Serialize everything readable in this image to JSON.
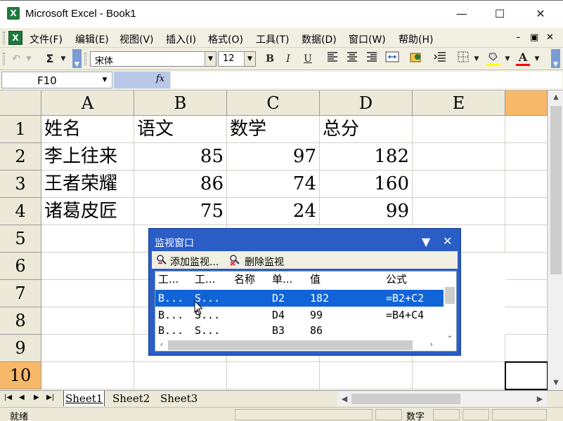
{
  "window": {
    "title": "Microsoft Excel - Book1",
    "minimize": "—",
    "maximize": "☐",
    "close": "✕",
    "icon": "X"
  },
  "menubar": {
    "items": [
      "文件(F)",
      "编辑(E)",
      "视图(V)",
      "插入(I)",
      "格式(O)",
      "工具(T)",
      "数据(D)",
      "窗口(W)",
      "帮助(H)"
    ],
    "mdi_min": "–",
    "mdi_restore": "▣",
    "mdi_close": "✕"
  },
  "toolbar": {
    "undo": "↶",
    "autosum": "Σ",
    "font_name": "宋体",
    "font_size": "12",
    "bold": "B",
    "italic": "I",
    "underline": "U",
    "fill_color": "#ffff00",
    "font_color": "#ff0000",
    "font_color_letter": "A"
  },
  "formula_bar": {
    "name_box": "F10",
    "fx": "fx",
    "formula": ""
  },
  "grid": {
    "columns": [
      "A",
      "B",
      "C",
      "D",
      "E"
    ],
    "rows": [
      "1",
      "2",
      "3",
      "4",
      "5",
      "6",
      "7",
      "8",
      "9",
      "10"
    ],
    "cells": {
      "A1": "姓名",
      "B1": "语文",
      "C1": "数学",
      "D1": "总分",
      "A2": "李上往来",
      "B2": "85",
      "C2": "97",
      "D2": "182",
      "A3": "王者荣耀",
      "B3": "86",
      "C3": "74",
      "D3": "160",
      "A4": "诸葛皮匠",
      "B4": "75",
      "C4": "24",
      "D4": "99"
    },
    "active_row": "10"
  },
  "sheets": {
    "tabs": [
      "Sheet1",
      "Sheet2",
      "Sheet3"
    ],
    "active": "Sheet1"
  },
  "status": {
    "ready": "就绪",
    "mode": "数字"
  },
  "watch_window": {
    "title": "监视窗口",
    "add_label": "添加监视...",
    "delete_label": "删除监视",
    "columns": [
      "工...",
      "工...",
      "名称",
      "单...",
      "值",
      "公式"
    ],
    "rows": [
      {
        "book": "B...",
        "sheet": "S...",
        "name": "",
        "cell": "D2",
        "value": "182",
        "formula": "=B2+C2"
      },
      {
        "book": "B...",
        "sheet": "S...",
        "name": "",
        "cell": "D4",
        "value": "99",
        "formula": "=B4+C4"
      },
      {
        "book": "B...",
        "sheet": "S...",
        "name": "",
        "cell": "B3",
        "value": "86",
        "formula": ""
      }
    ],
    "selected_row": 0
  }
}
